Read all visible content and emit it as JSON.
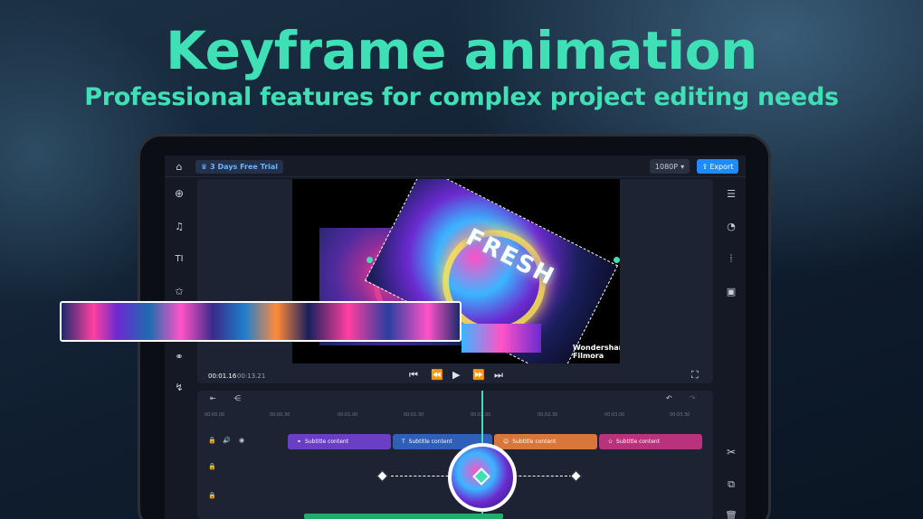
{
  "hero": {
    "title": "Keyframe animation",
    "subtitle": "Professional features for complex project editing needs"
  },
  "topbar": {
    "trial_label": "3 Days Free Trial",
    "resolution": "1080P",
    "export_label": "Export"
  },
  "preview": {
    "watermark_line1": "Wondershare",
    "watermark_line2": "Filmora",
    "overlay_text": "FRESH",
    "current_time": "00:01.16",
    "total_time": "00:13.21"
  },
  "timeline": {
    "ruler": [
      "00:00.00",
      "00:00.30",
      "00:01.00",
      "00:01.30",
      "00:02.00",
      "00:02.30",
      "00:03.00",
      "00:03.30"
    ],
    "clips": [
      {
        "label": "Subtitle content",
        "color": "#6a3fc4"
      },
      {
        "label": "Subtitle content",
        "color": "#2f5fb8"
      },
      {
        "label": "Subtitle content",
        "color": "#d9763a"
      },
      {
        "label": "Subtitle content",
        "color": "#b8327c"
      }
    ]
  },
  "colors": {
    "accent": "#3fe0b5",
    "export": "#1e8cff"
  }
}
